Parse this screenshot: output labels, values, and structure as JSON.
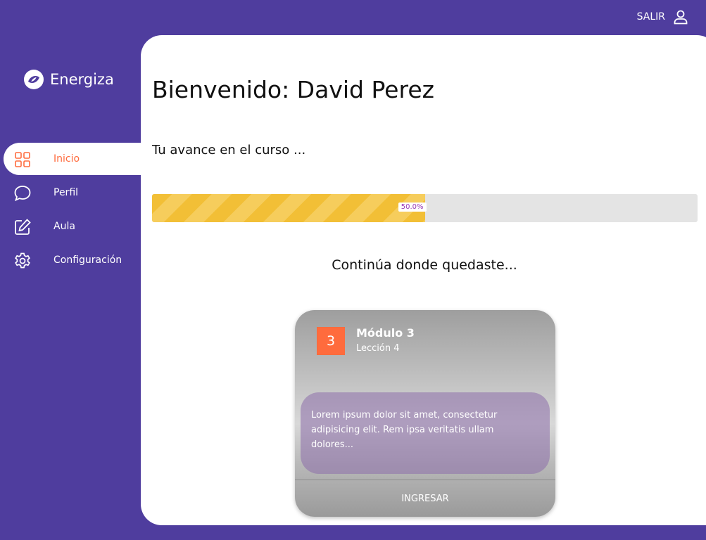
{
  "topbar": {
    "logout_label": "SALIR"
  },
  "brand": {
    "name": "Energiza"
  },
  "sidebar": {
    "items": [
      {
        "label": "Inicio",
        "icon": "grid-icon",
        "active": true
      },
      {
        "label": "Perfil",
        "icon": "chat-bubble-icon",
        "active": false
      },
      {
        "label": "Aula",
        "icon": "edit-icon",
        "active": false
      },
      {
        "label": "Configuración",
        "icon": "gear-icon",
        "active": false
      }
    ]
  },
  "main": {
    "welcome": "Bienvenido: David Perez",
    "progress_caption": "Tu avance en el curso ...",
    "progress": {
      "value": 0.5,
      "label": "50.0%"
    },
    "continue_title": "Continúa donde quedaste..."
  },
  "card": {
    "module_number": "3",
    "module_title": "Módulo 3",
    "lesson": "Lección 4",
    "description": "Lorem ipsum dolor sit amet, consectetur adipisicing elit. Rem ipsa veritatis ullam dolores...",
    "cta_label": "INGRESAR"
  },
  "colors": {
    "background": "#4f3d9e",
    "accent": "#ff6b3d",
    "progress_fill": "#f2bf36",
    "progress_text": "#9a3bb8"
  }
}
